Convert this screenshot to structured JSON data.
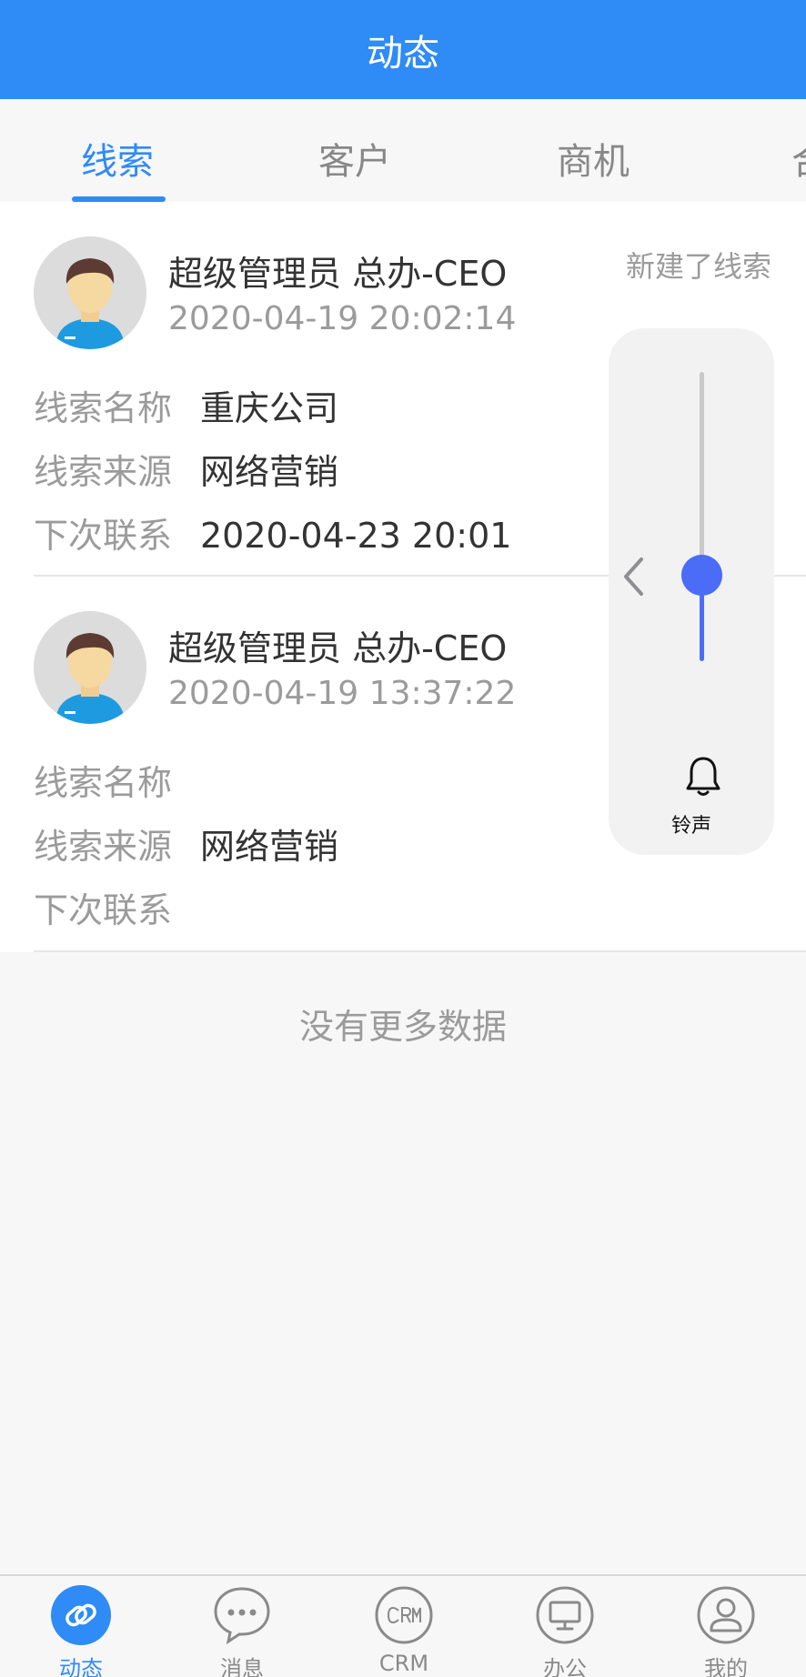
{
  "header": {
    "title": "动态"
  },
  "tabs": [
    {
      "label": "线索",
      "active": true
    },
    {
      "label": "客户",
      "active": false
    },
    {
      "label": "商机",
      "active": false
    },
    {
      "label": "合",
      "active": false
    }
  ],
  "feed": [
    {
      "name": "超级管理员  总办-CEO",
      "time": "2020-04-19 20:02:14",
      "action": "新建了线索",
      "fields": [
        {
          "key": "线索名称",
          "value": "重庆公司"
        },
        {
          "key": "线索来源",
          "value": "网络营销"
        },
        {
          "key": "下次联系",
          "value": "2020-04-23 20:01"
        }
      ]
    },
    {
      "name": "超级管理员  总办-CEO",
      "time": "2020-04-19 13:37:22",
      "action": "",
      "fields": [
        {
          "key": "线索名称",
          "value": ""
        },
        {
          "key": "线索来源",
          "value": "网络营销"
        },
        {
          "key": "下次联系",
          "value": ""
        }
      ]
    }
  ],
  "footer_text": "没有更多数据",
  "volume_overlay": {
    "label": "铃声",
    "level": 0.3,
    "icon": "bell-icon"
  },
  "tabbar": [
    {
      "label": "动态",
      "icon": "link-icon",
      "active": true
    },
    {
      "label": "消息",
      "icon": "chat-bubble-icon",
      "active": false
    },
    {
      "label": "CRM",
      "icon": "crm-icon",
      "active": false
    },
    {
      "label": "办公",
      "icon": "monitor-icon",
      "active": false
    },
    {
      "label": "我的",
      "icon": "user-icon",
      "active": false
    }
  ],
  "colors": {
    "brand": "#2f8bf5",
    "slider": "#4a6cf7"
  }
}
